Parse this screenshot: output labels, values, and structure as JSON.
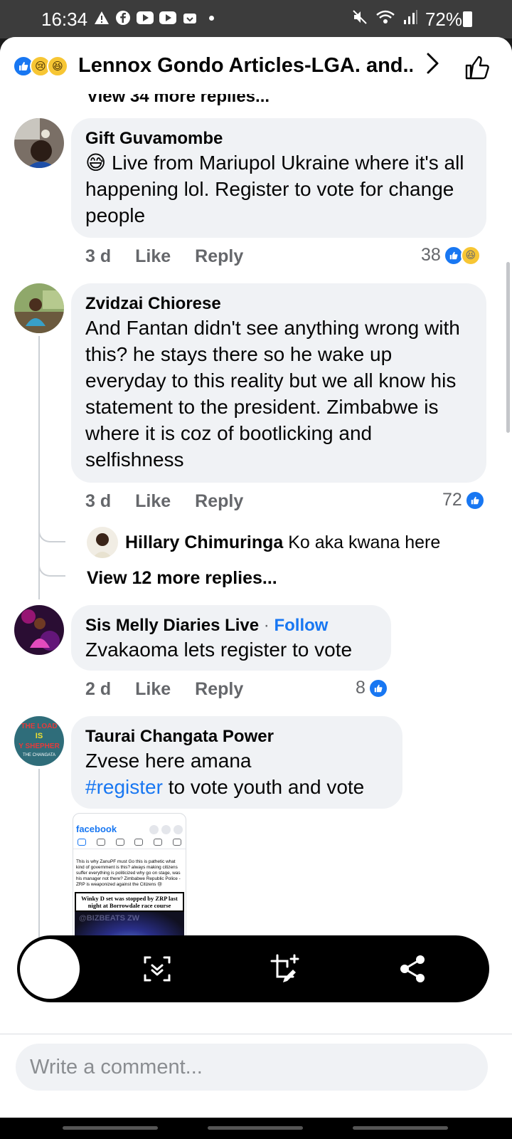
{
  "status_bar": {
    "time": "16:34",
    "battery": "72%",
    "icons_left": [
      "warning-icon",
      "facebook-icon",
      "youtube-icon",
      "youtube-icon",
      "inbox-icon",
      "dot-icon"
    ],
    "icons_right": [
      "mute-icon",
      "wifi-icon",
      "signal-icon",
      "battery-icon"
    ]
  },
  "header": {
    "title": "Lennox Gondo Articles-LGA. and...",
    "reactions": [
      "like",
      "sad",
      "haha"
    ]
  },
  "partial_top": "View 34 more replies...",
  "comments": [
    {
      "name": "Gift Guvamombe",
      "text_emoji": "😅",
      "text": "Live from Mariupol Ukraine where it's all happening lol. Register to vote for change people",
      "time": "3 d",
      "like": "Like",
      "reply": "Reply",
      "reaction_count": "38"
    },
    {
      "name": "Zvidzai Chiorese",
      "text": "And Fantan didn't see anything wrong with this? he stays there so he wake up everyday to this reality but we all know his statement to the president. Zimbabwe is where it is coz of bootlicking and selfishness",
      "time": "3 d",
      "like": "Like",
      "reply": "Reply",
      "reaction_count": "72",
      "reply_preview": {
        "name": "Hillary Chimuringa",
        "text": "Ko aka kwana here"
      },
      "view_more": "View 12 more replies..."
    },
    {
      "name": "Sis Melly Diaries Live",
      "follow_sep": "·",
      "follow": "Follow",
      "text": "Zvakaoma lets register to vote",
      "time": "2 d",
      "like": "Like",
      "reply": "Reply",
      "reaction_count": "8"
    },
    {
      "name": "Taurai Changata Power",
      "text_line1": "Zvese here amana",
      "hashtag": "#register",
      "text_line2_rest": " to vote youth and vote",
      "avatar_text": {
        "line1": "THE LOAD",
        "line2": "IS",
        "line3": "Y SHEPHER",
        "line4": "THE CHANGATA"
      },
      "attachment": {
        "brand": "facebook",
        "post_text": "This is why ZanuPF must Go this is pathetic what kind of government is this? always making citizens suffer everything is politicized why go on stage, was his manager not there? Zimbabwe Republic Police - ZRP is weaponized against the Citizens 😢",
        "caption": "Winky D set was stopped by ZRP last night at Borrowdale race course",
        "watermark": "@BIZBEATS ZW"
      }
    }
  ],
  "composer": {
    "placeholder": "Write a comment..."
  },
  "colors": {
    "accent": "#1877f2",
    "bubble": "#f0f2f5",
    "muted_text": "#65676b"
  }
}
